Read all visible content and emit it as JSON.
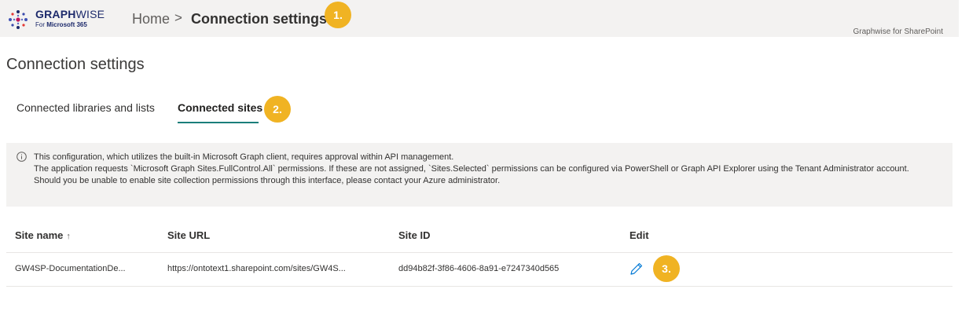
{
  "header": {
    "logo": {
      "title_bold": "GRAPH",
      "title_light": "WISE",
      "sub_prefix": "For",
      "sub_bold": "Microsoft 365"
    },
    "breadcrumb": {
      "home": "Home",
      "separator": ">",
      "current": "Connection settings"
    },
    "app_name": "Graphwise for SharePoint"
  },
  "badges": {
    "one": "1.",
    "two": "2.",
    "three": "3."
  },
  "page": {
    "title": "Connection settings"
  },
  "tabs": [
    {
      "label": "Connected libraries and lists",
      "selected": false
    },
    {
      "label": "Connected sites",
      "selected": true
    }
  ],
  "info": {
    "icon": "info-icon",
    "lines": [
      "This configuration, which utilizes the built-in Microsoft Graph client, requires approval within API management.",
      "The application requests `Microsoft Graph Sites.FullControl.All` permissions. If these are not assigned, `Sites.Selected` permissions can be configured via PowerShell or Graph API Explorer using the Tenant Administrator account.",
      "Should you be unable to enable site collection permissions through this interface, please contact your Azure administrator."
    ]
  },
  "table": {
    "columns": {
      "name": "Site name",
      "sort_indicator": "↑",
      "url": "Site URL",
      "id": "Site ID",
      "edit": "Edit"
    },
    "rows": [
      {
        "name": "GW4SP-DocumentationDe...",
        "url": "https://ontotext1.sharepoint.com/sites/GW4S...",
        "id": "dd94b82f-3f86-4606-8a91-e7247340d565",
        "edit_icon": "pencil-icon"
      }
    ]
  },
  "colors": {
    "accent": "#1a7e7a",
    "badge": "#f0b323",
    "brand": "#1d2a6b",
    "edit_icon": "#0078d4"
  }
}
